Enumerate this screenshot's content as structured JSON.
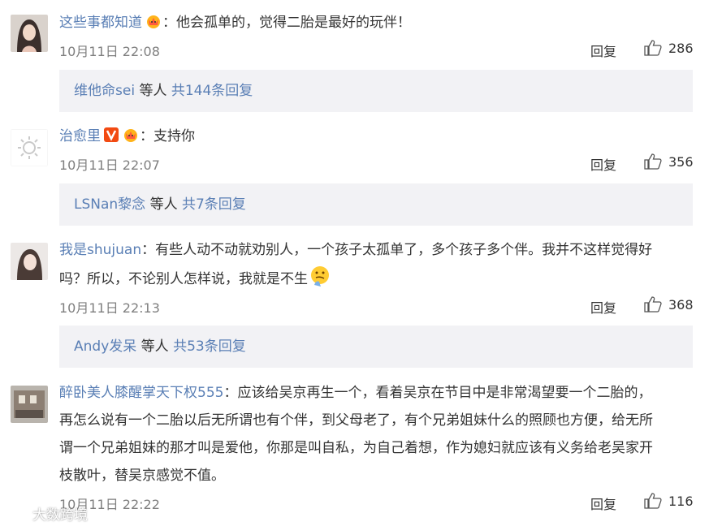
{
  "reply_label": "回复",
  "others_text": "等人",
  "comments": [
    {
      "user": "这些事都知道",
      "text": "：他会孤单的，觉得二胎是最好的玩伴！",
      "time": "10月11日 22:08",
      "likes": "286",
      "reply_users": "维他命sei",
      "reply_count": "共144条回复"
    },
    {
      "user": "治愈里",
      "text": "：支持你",
      "time": "10月11日 22:07",
      "likes": "356",
      "reply_users": "LSNan黎念",
      "reply_count": "共7条回复"
    },
    {
      "user": "我是shujuan",
      "text_line1": "：有些人动不动就劝别人，一个孩子太孤单了，多个孩子多个伴。我并不这样觉得好",
      "text_line2": "吗？所以，不论别人怎样说，我就是不生",
      "time": "10月11日 22:13",
      "likes": "368",
      "reply_users": "Andy发呆",
      "reply_count": "共53条回复"
    },
    {
      "user": "醉卧美人膝醒掌天下权555",
      "text_line1": "：应该给吴京再生一个，看着吴京在节目中是非常渴望要一个二胎的，",
      "text_line2": "再怎么说有一个二胎以后无所谓也有个伴，到父母老了，有个兄弟姐妹什么的照顾也方便，给无所",
      "text_line3": "谓一个兄弟姐妹的那才叫是爱他，你那是叫自私，为自己着想，作为媳妇就应该有义务给老吴家开",
      "text_line4": "枝散叶，替吴京感觉不值。",
      "time": "10月11日 22:22",
      "likes": "116"
    }
  ],
  "watermark": "大数跨境",
  "colors": {
    "link": "#5a7fb5",
    "replies_bg": "#f2f2f5",
    "meta": "#7f7f7f"
  }
}
